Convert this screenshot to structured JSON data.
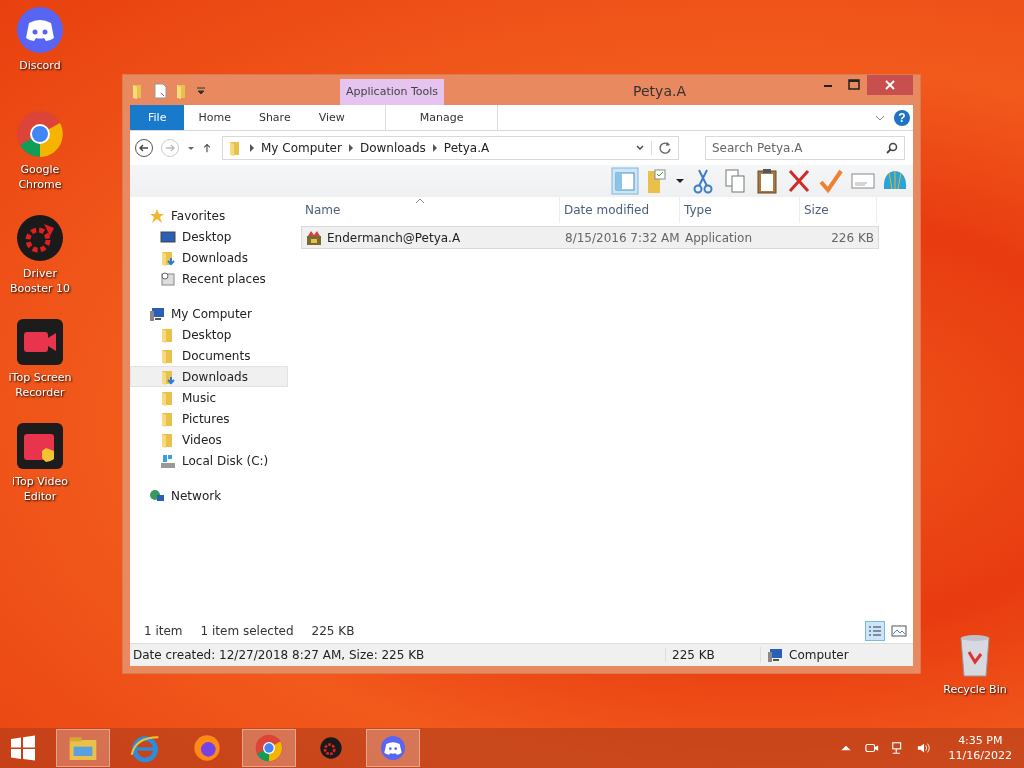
{
  "desktop_icons": [
    {
      "label": "Discord",
      "kind": "discord"
    },
    {
      "label": "Google Chrome",
      "kind": "chrome"
    },
    {
      "label": "Driver Booster 10",
      "kind": "booster"
    },
    {
      "label": "iTop Screen Recorder",
      "kind": "recorder"
    },
    {
      "label": "iTop Video Editor",
      "kind": "editor"
    }
  ],
  "recycle_bin": {
    "label": "Recycle Bin"
  },
  "window": {
    "title": "Petya.A",
    "context_group": "Application Tools",
    "help": "?",
    "ribbon_tabs": [
      {
        "label": "File",
        "kind": "file"
      },
      {
        "label": "Home",
        "kind": "plain"
      },
      {
        "label": "Share",
        "kind": "plain"
      },
      {
        "label": "View",
        "kind": "plain"
      },
      {
        "label": "Manage",
        "kind": "context"
      }
    ],
    "path": [
      "My Computer",
      "Downloads",
      "Petya.A"
    ],
    "search": {
      "placeholder": "Search Petya.A"
    },
    "nav": [
      {
        "label": "Favorites",
        "kind": "star",
        "selected": false,
        "children": [
          {
            "label": "Desktop",
            "kind": "desktop",
            "selected": false
          },
          {
            "label": "Downloads",
            "kind": "download",
            "selected": false
          },
          {
            "label": "Recent places",
            "kind": "recent",
            "selected": false
          }
        ]
      },
      {
        "label": "My Computer",
        "kind": "computer",
        "selected": false,
        "children": [
          {
            "label": "Desktop",
            "kind": "folder",
            "selected": false
          },
          {
            "label": "Documents",
            "kind": "folder",
            "selected": false
          },
          {
            "label": "Downloads",
            "kind": "download",
            "selected": true
          },
          {
            "label": "Music",
            "kind": "folder",
            "selected": false
          },
          {
            "label": "Pictures",
            "kind": "folder",
            "selected": false
          },
          {
            "label": "Videos",
            "kind": "folder",
            "selected": false
          },
          {
            "label": "Local Disk (C:)",
            "kind": "disk",
            "selected": false
          }
        ]
      },
      {
        "label": "Network",
        "kind": "network",
        "selected": false
      }
    ],
    "columns": [
      "Name",
      "Date modified",
      "Type",
      "Size"
    ],
    "rows": [
      {
        "name": "Endermanch@Petya.A",
        "date": "8/15/2016 7:32 AM",
        "type": "Application",
        "size": "226 KB",
        "selected": true
      }
    ],
    "item_count": "1 item",
    "selection": "1 item selected",
    "selection_size": "225 KB",
    "details": {
      "info": "Date created: 12/27/2018 8:27 AM, Size: 225 KB",
      "size": "225 KB",
      "location": "Computer"
    }
  },
  "taskbar": {
    "apps": [
      {
        "kind": "explorer",
        "open": true
      },
      {
        "kind": "ie",
        "open": false
      },
      {
        "kind": "firefox",
        "open": false
      },
      {
        "kind": "chrome",
        "open": true
      },
      {
        "kind": "booster",
        "open": false
      },
      {
        "kind": "discord",
        "open": true
      }
    ],
    "time": "4:35 PM",
    "date": "11/16/2022"
  }
}
